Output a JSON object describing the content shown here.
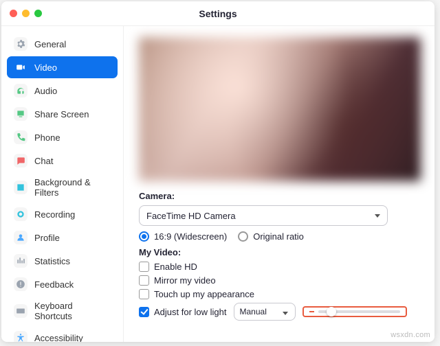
{
  "window": {
    "title": "Settings"
  },
  "sidebar": {
    "items": [
      {
        "label": "General"
      },
      {
        "label": "Video"
      },
      {
        "label": "Audio"
      },
      {
        "label": "Share Screen"
      },
      {
        "label": "Phone"
      },
      {
        "label": "Chat"
      },
      {
        "label": "Background & Filters"
      },
      {
        "label": "Recording"
      },
      {
        "label": "Profile"
      },
      {
        "label": "Statistics"
      },
      {
        "label": "Feedback"
      },
      {
        "label": "Keyboard Shortcuts"
      },
      {
        "label": "Accessibility"
      }
    ],
    "active_index": 1
  },
  "camera": {
    "section_label": "Camera:",
    "selected": "FaceTime HD Camera",
    "aspect": {
      "widescreen_label": "16:9 (Widescreen)",
      "original_label": "Original ratio",
      "selected": "widescreen"
    }
  },
  "my_video": {
    "section_label": "My Video:",
    "enable_hd": {
      "label": "Enable HD",
      "checked": false
    },
    "mirror": {
      "label": "Mirror my video",
      "checked": false
    },
    "touch_up": {
      "label": "Touch up my appearance",
      "checked": false
    },
    "low_light": {
      "label": "Adjust for low light",
      "checked": true,
      "mode": "Manual",
      "slider_value": 10,
      "slider_min": 0,
      "slider_max": 100
    }
  },
  "watermark": "wsxdn.com"
}
